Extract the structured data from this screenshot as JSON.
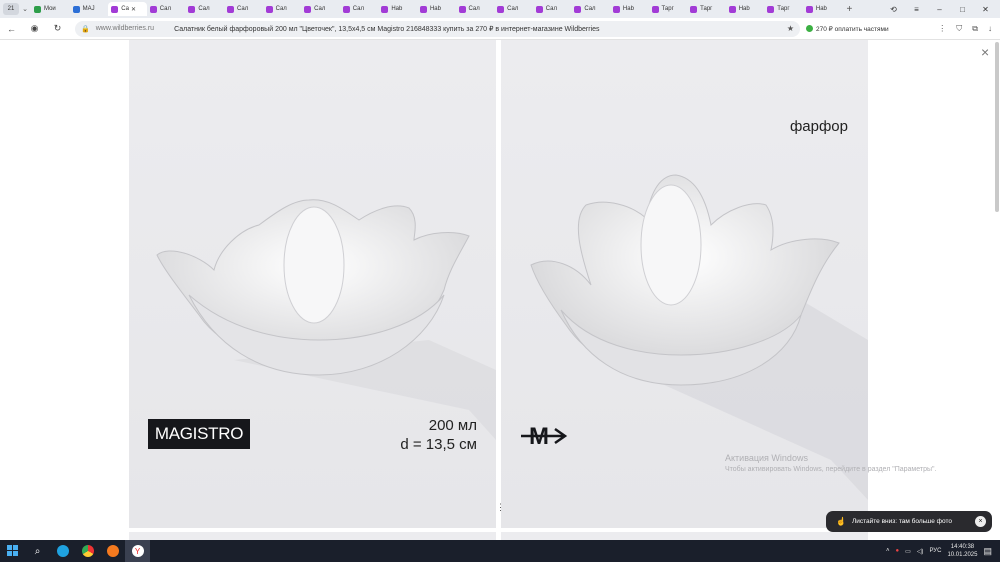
{
  "browser": {
    "tab_count": "21",
    "tabs": [
      {
        "label": "Мои",
        "color": "#2e9e4a"
      },
      {
        "label": "MAJ",
        "color": "#2c6fd6"
      },
      {
        "label": "Са",
        "color": "#a23bd6",
        "active": true
      },
      {
        "label": "Сал",
        "color": "#a23bd6"
      },
      {
        "label": "Сал",
        "color": "#a23bd6"
      },
      {
        "label": "Сал",
        "color": "#a23bd6"
      },
      {
        "label": "Сал",
        "color": "#a23bd6"
      },
      {
        "label": "Сал",
        "color": "#a23bd6"
      },
      {
        "label": "Сал",
        "color": "#a23bd6"
      },
      {
        "label": "Hab",
        "color": "#a23bd6"
      },
      {
        "label": "Hab",
        "color": "#a23bd6"
      },
      {
        "label": "Сал",
        "color": "#a23bd6"
      },
      {
        "label": "Сал",
        "color": "#a23bd6"
      },
      {
        "label": "Сал",
        "color": "#a23bd6"
      },
      {
        "label": "Сал",
        "color": "#a23bd6"
      },
      {
        "label": "Hab",
        "color": "#a23bd6"
      },
      {
        "label": "Тарг",
        "color": "#a23bd6"
      },
      {
        "label": "Тарг",
        "color": "#a23bd6"
      },
      {
        "label": "Hab",
        "color": "#a23bd6"
      },
      {
        "label": "Тарг",
        "color": "#a23bd6"
      },
      {
        "label": "Hab",
        "color": "#a23bd6"
      }
    ],
    "new_tab": "+",
    "url_domain": "www.wildberries.ru",
    "page_title": "Салатник белый фарфоровый 200 мл \"Цветочек\", 13,5х4,5 см Magistro 216848333 купить за 270 ₽ в интернет-магазине Wildberries",
    "pay_offer": "270 ₽ оплатить частями"
  },
  "viewer": {
    "brand_logo": "MAGISTRO",
    "volume": "200 мл",
    "diameter": "d = 13,5 см",
    "material": "фарфор",
    "brand_mark": "M",
    "close": "×",
    "dots": "⋮"
  },
  "windows": {
    "activate_title": "Активация Windows",
    "activate_sub": "Чтобы активировать Windows, перейдите в раздел \"Параметры\"."
  },
  "toast": {
    "text": "Листайте вниз: там больше фото",
    "close": "×"
  },
  "taskbar": {
    "lang": "РУС",
    "time": "14:40:38",
    "date": "10.01.2025"
  },
  "colors": {
    "accent": "#a23bd6",
    "taskbar": "#1a1f2b",
    "logo_bg": "#16171b"
  }
}
